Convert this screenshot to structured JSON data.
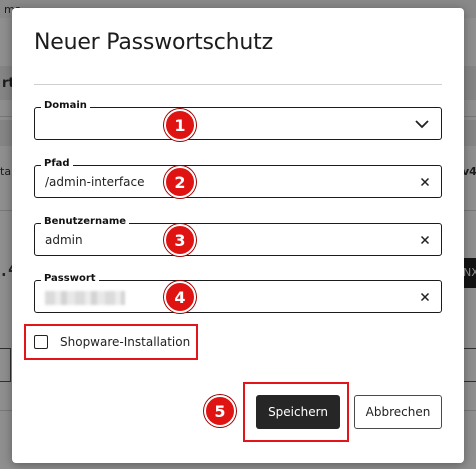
{
  "background": {
    "texts": [
      "ma",
      "rt",
      "ta",
      "v4",
      ".4",
      "NX"
    ]
  },
  "dialog": {
    "title": "Neuer Passwortschutz",
    "fields": {
      "domain": {
        "label": "Domain",
        "value": ""
      },
      "pfad": {
        "label": "Pfad",
        "value": "/admin-interface"
      },
      "benutzername": {
        "label": "Benutzername",
        "value": "admin"
      },
      "passwort": {
        "label": "Passwort",
        "value": ""
      }
    },
    "checkbox": {
      "label": "Shopware-Installation",
      "checked": false
    },
    "buttons": {
      "save": "Speichern",
      "cancel": "Abbrechen"
    }
  },
  "annotations": {
    "markers": [
      "1",
      "2",
      "3",
      "4",
      "5"
    ],
    "highlight_color": "#e3141a",
    "marker_color": "#e01313"
  },
  "icons": {
    "domain": "chevron-down-icon",
    "clear": "clear-x-icon"
  }
}
